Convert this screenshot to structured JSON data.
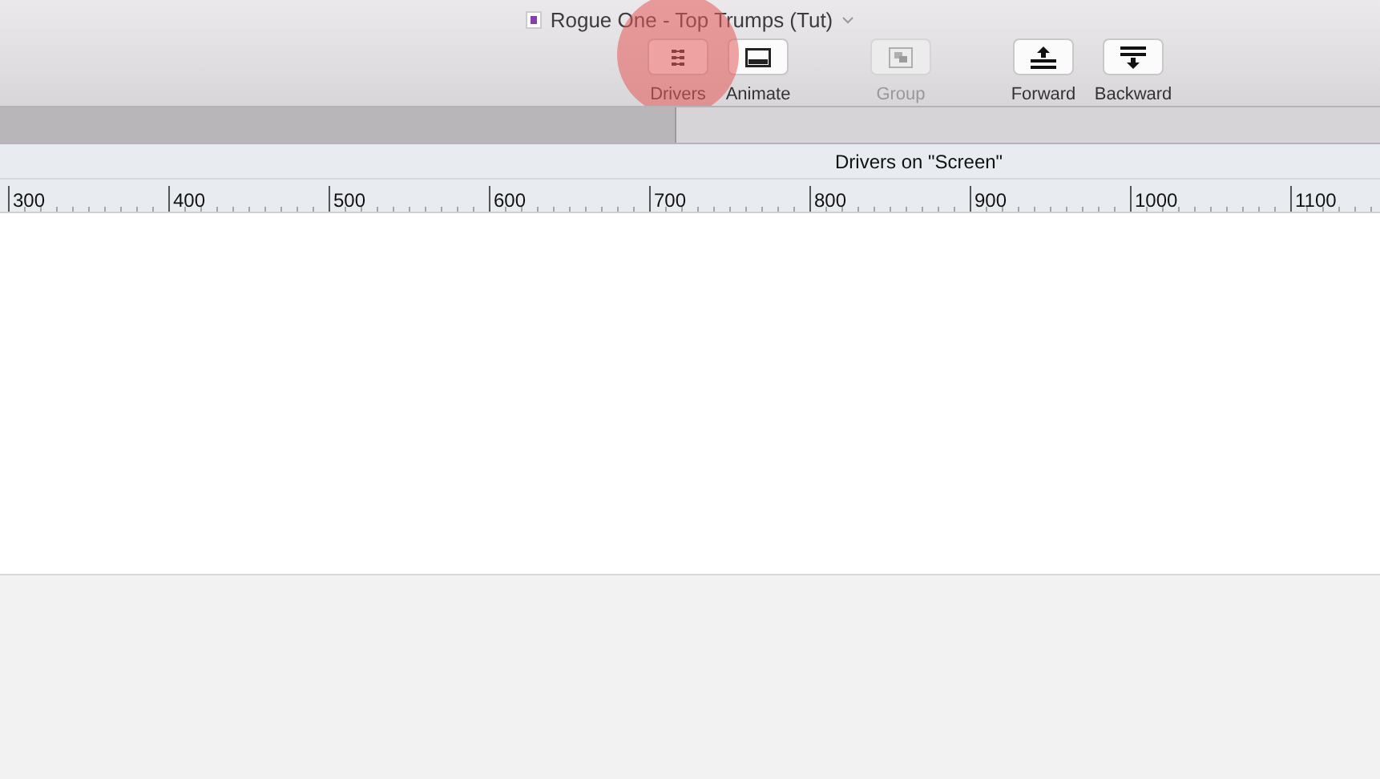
{
  "window": {
    "title": "Rogue One - Top Trumps (Tut)"
  },
  "toolbar": [
    {
      "label": "Drivers",
      "kind": "drivers",
      "disabled": false
    },
    {
      "label": "Animate",
      "kind": "animate",
      "disabled": false
    },
    {
      "label": "Group",
      "kind": "group",
      "disabled": true
    },
    {
      "label": "Forward",
      "kind": "forward",
      "disabled": false
    },
    {
      "label": "Backward",
      "kind": "backward",
      "disabled": false
    }
  ],
  "panel_title": "Drivers on \"Screen\"",
  "ruler": {
    "labels": [
      "300",
      "400",
      "500",
      "600",
      "700",
      "800",
      "900",
      "1000",
      "1100"
    ]
  }
}
